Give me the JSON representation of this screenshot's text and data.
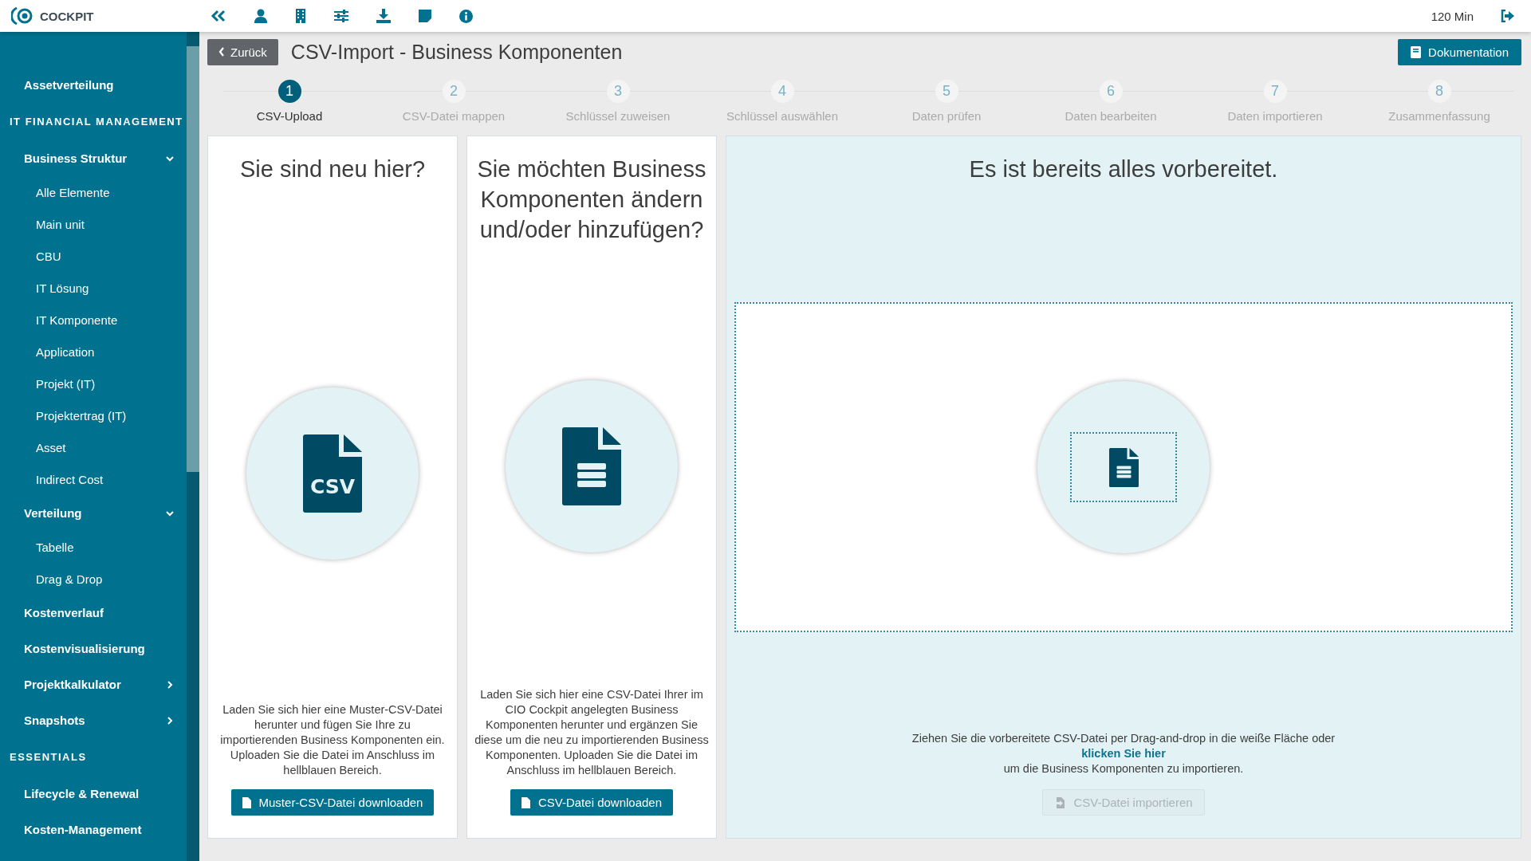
{
  "topbar": {
    "logo": "COCKPIT",
    "timer": "120 Min"
  },
  "sidebar": {
    "items": [
      {
        "kind": "link",
        "label": "Assetverteilung"
      },
      {
        "kind": "heading",
        "label": "IT FINANCIAL MANAGEMENT"
      },
      {
        "kind": "group",
        "label": "Business Struktur",
        "expanded": true,
        "children": [
          {
            "label": "Alle Elemente"
          },
          {
            "label": "Main unit"
          },
          {
            "label": "CBU"
          },
          {
            "label": "IT Lösung"
          },
          {
            "label": "IT Komponente"
          },
          {
            "label": "Application"
          },
          {
            "label": "Projekt (IT)"
          },
          {
            "label": "Projektertrag (IT)"
          },
          {
            "label": "Asset"
          },
          {
            "label": "Indirect Cost"
          }
        ]
      },
      {
        "kind": "group",
        "label": "Verteilung",
        "expanded": true,
        "children": [
          {
            "label": "Tabelle"
          },
          {
            "label": "Drag & Drop"
          }
        ]
      },
      {
        "kind": "link",
        "label": "Kostenverlauf"
      },
      {
        "kind": "link",
        "label": "Kostenvisualisierung"
      },
      {
        "kind": "group",
        "label": "Projektkalkulator",
        "expanded": false
      },
      {
        "kind": "group",
        "label": "Snapshots",
        "expanded": false
      },
      {
        "kind": "heading",
        "label": "ESSENTIALS"
      },
      {
        "kind": "link",
        "label": "Lifecycle & Renewal"
      },
      {
        "kind": "link",
        "label": "Kosten-Management"
      }
    ]
  },
  "header": {
    "back": "Zurück",
    "title": "CSV-Import - Business Komponenten",
    "docs": "Dokumentation"
  },
  "steps": [
    {
      "number": "1",
      "label": "CSV-Upload",
      "selected": true
    },
    {
      "number": "2",
      "label": "CSV-Datei mappen",
      "selected": false
    },
    {
      "number": "3",
      "label": "Schlüssel zuweisen",
      "selected": false
    },
    {
      "number": "4",
      "label": "Schlüssel auswählen",
      "selected": false
    },
    {
      "number": "5",
      "label": "Daten prüfen",
      "selected": false
    },
    {
      "number": "6",
      "label": "Daten bearbeiten",
      "selected": false
    },
    {
      "number": "7",
      "label": "Daten importieren",
      "selected": false
    },
    {
      "number": "8",
      "label": "Zusammenfassung",
      "selected": false
    }
  ],
  "cards": [
    {
      "kind": "download",
      "title": "Sie sind neu hier?",
      "icon_text": "CSV",
      "text": "Laden Sie sich hier eine Muster-CSV-Datei herunter und fügen Sie Ihre zu importierenden Business Komponenten ein. Uploaden Sie die Datei im Anschluss im hellblauen Bereich.",
      "button": "Muster-CSV-Datei downloaden"
    },
    {
      "kind": "download",
      "title": "Sie möchten Business Komponenten ändern und/oder hinzufügen?",
      "text": "Laden Sie sich hier eine CSV-Datei Ihrer im CIO Cockpit angelegten Business Komponenten herunter und ergänzen Sie diese um die neu zu importierenden Business Komponenten. Uploaden Sie die Datei im Anschluss im hellblauen Bereich.",
      "button": "CSV-Datei downloaden"
    },
    {
      "kind": "upload",
      "title": "Es ist bereits alles vorbereitet.",
      "text": "Ziehen Sie die vorbereitete CSV-Datei per Drag-and-drop in die weiße Fläche oder",
      "link": "klicken Sie hier",
      "text_after": "um die Business Komponenten zu importieren.",
      "button": "CSV-Datei importieren",
      "disabled": true
    }
  ]
}
